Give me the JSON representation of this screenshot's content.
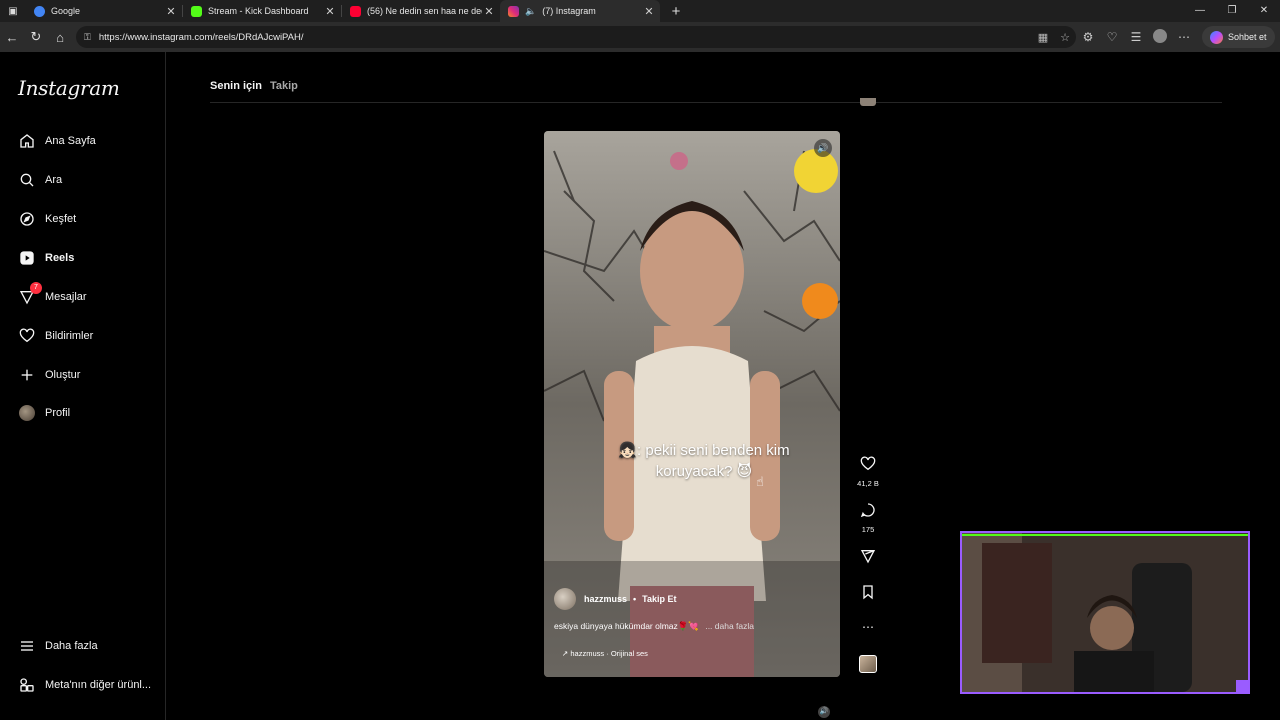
{
  "browser": {
    "tabs": [
      {
        "title": "Google",
        "favicon_color": "#4285f4",
        "active": false
      },
      {
        "title": "Stream - Kick Dashboard",
        "favicon_color": "#53fc18",
        "active": false
      },
      {
        "title": "(56) Ne dedin sen haa ne dedin s",
        "favicon_color": "#ff0033",
        "active": false
      },
      {
        "title": "(7) Instagram",
        "favicon_color": "#e1306c",
        "active": true
      }
    ],
    "url": "https://www.instagram.com/reels/DRdAJcwiPAH/",
    "copilot_label": "Sohbet et"
  },
  "sidebar": {
    "logo": "Instagram",
    "items": [
      {
        "label": "Ana Sayfa",
        "icon": "home-icon"
      },
      {
        "label": "Ara",
        "icon": "search-icon"
      },
      {
        "label": "Keşfet",
        "icon": "compass-icon"
      },
      {
        "label": "Reels",
        "icon": "reels-icon"
      },
      {
        "label": "Mesajlar",
        "icon": "messenger-icon",
        "badge": "7"
      },
      {
        "label": "Bildirimler",
        "icon": "heart-icon"
      },
      {
        "label": "Oluştur",
        "icon": "plus-icon"
      },
      {
        "label": "Profil",
        "icon": "profile-avatar"
      }
    ],
    "more_label": "Daha fazla",
    "meta_label": "Meta'nın diğer ürünl..."
  },
  "feed_tabs": {
    "for_you": "Senin için",
    "following": "Takip"
  },
  "reel": {
    "caption_overlay_line1": "👧🏻: pekii seni benden kim",
    "caption_overlay_line2": "koruyacak? 😈",
    "username": "hazzmuss",
    "follow_label": "Takip Et",
    "description": "eskiya dünyaya hükümdar olmaz🌹💘",
    "more_label": "... daha fazla",
    "audio": "hazzmuss · Orijinal ses"
  },
  "actions": {
    "likes": "41,2 B",
    "comments": "175"
  }
}
